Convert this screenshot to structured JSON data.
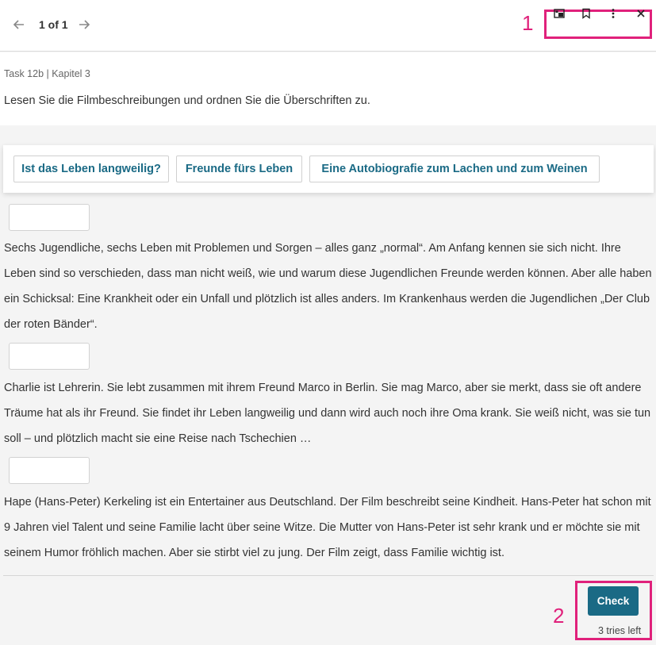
{
  "nav": {
    "page_indicator": "1 of 1",
    "prev_icon": "arrow-left-icon",
    "next_icon": "arrow-right-icon"
  },
  "annotations": {
    "label_1": "1",
    "label_2": "2",
    "color": "#e0217b"
  },
  "toolbar": {
    "icons": [
      "picture-in-picture-icon",
      "bookmark-icon",
      "more-vertical-icon",
      "close-icon"
    ]
  },
  "task": {
    "meta": "Task 12b | Kapitel 3",
    "instruction": "Lesen Sie die Filmbeschreibungen und ordnen Sie die Überschriften zu."
  },
  "options": [
    "Ist das Leben langweilig?",
    "Freunde fürs Leben",
    "Eine Autobiografie zum Lachen und zum Weinen"
  ],
  "paragraphs": [
    "Sechs Jugendliche, sechs Leben mit Problemen und Sorgen – alles ganz „normal“. Am Anfang kennen sie sich nicht. Ihre Leben sind so verschieden, dass man nicht weiß, wie und warum diese Jugendlichen Freunde werden können. Aber alle haben ein Schicksal: Eine Krankheit oder ein Unfall und plötzlich ist alles anders. Im Krankenhaus werden die Jugendlichen „Der Club der roten Bänder“.",
    "Charlie ist Lehrerin. Sie lebt zusammen mit ihrem Freund Marco in Berlin. Sie mag Marco, aber sie merkt, dass sie oft andere Träume hat als ihr Freund. Sie findet ihr Leben langweilig und dann wird auch noch ihre Oma krank. Sie weiß nicht, was sie tun soll – und plötzlich macht sie eine Reise nach Tschechien …",
    "Hape (Hans-Peter) Kerkeling ist ein Entertainer aus Deutschland. Der Film beschreibt seine Kindheit. Hans-Peter hat schon mit 9 Jahren viel Talent und seine Familie lacht über seine Witze. Die Mutter von Hans-Peter ist sehr krank und er möchte sie mit seinem Humor fröhlich machen. Aber sie stirbt viel zu jung. Der Film zeigt, dass Familie wichtig ist."
  ],
  "footer": {
    "check_label": "Check",
    "tries_left": "3 tries left",
    "accent": "#1a6a85"
  }
}
